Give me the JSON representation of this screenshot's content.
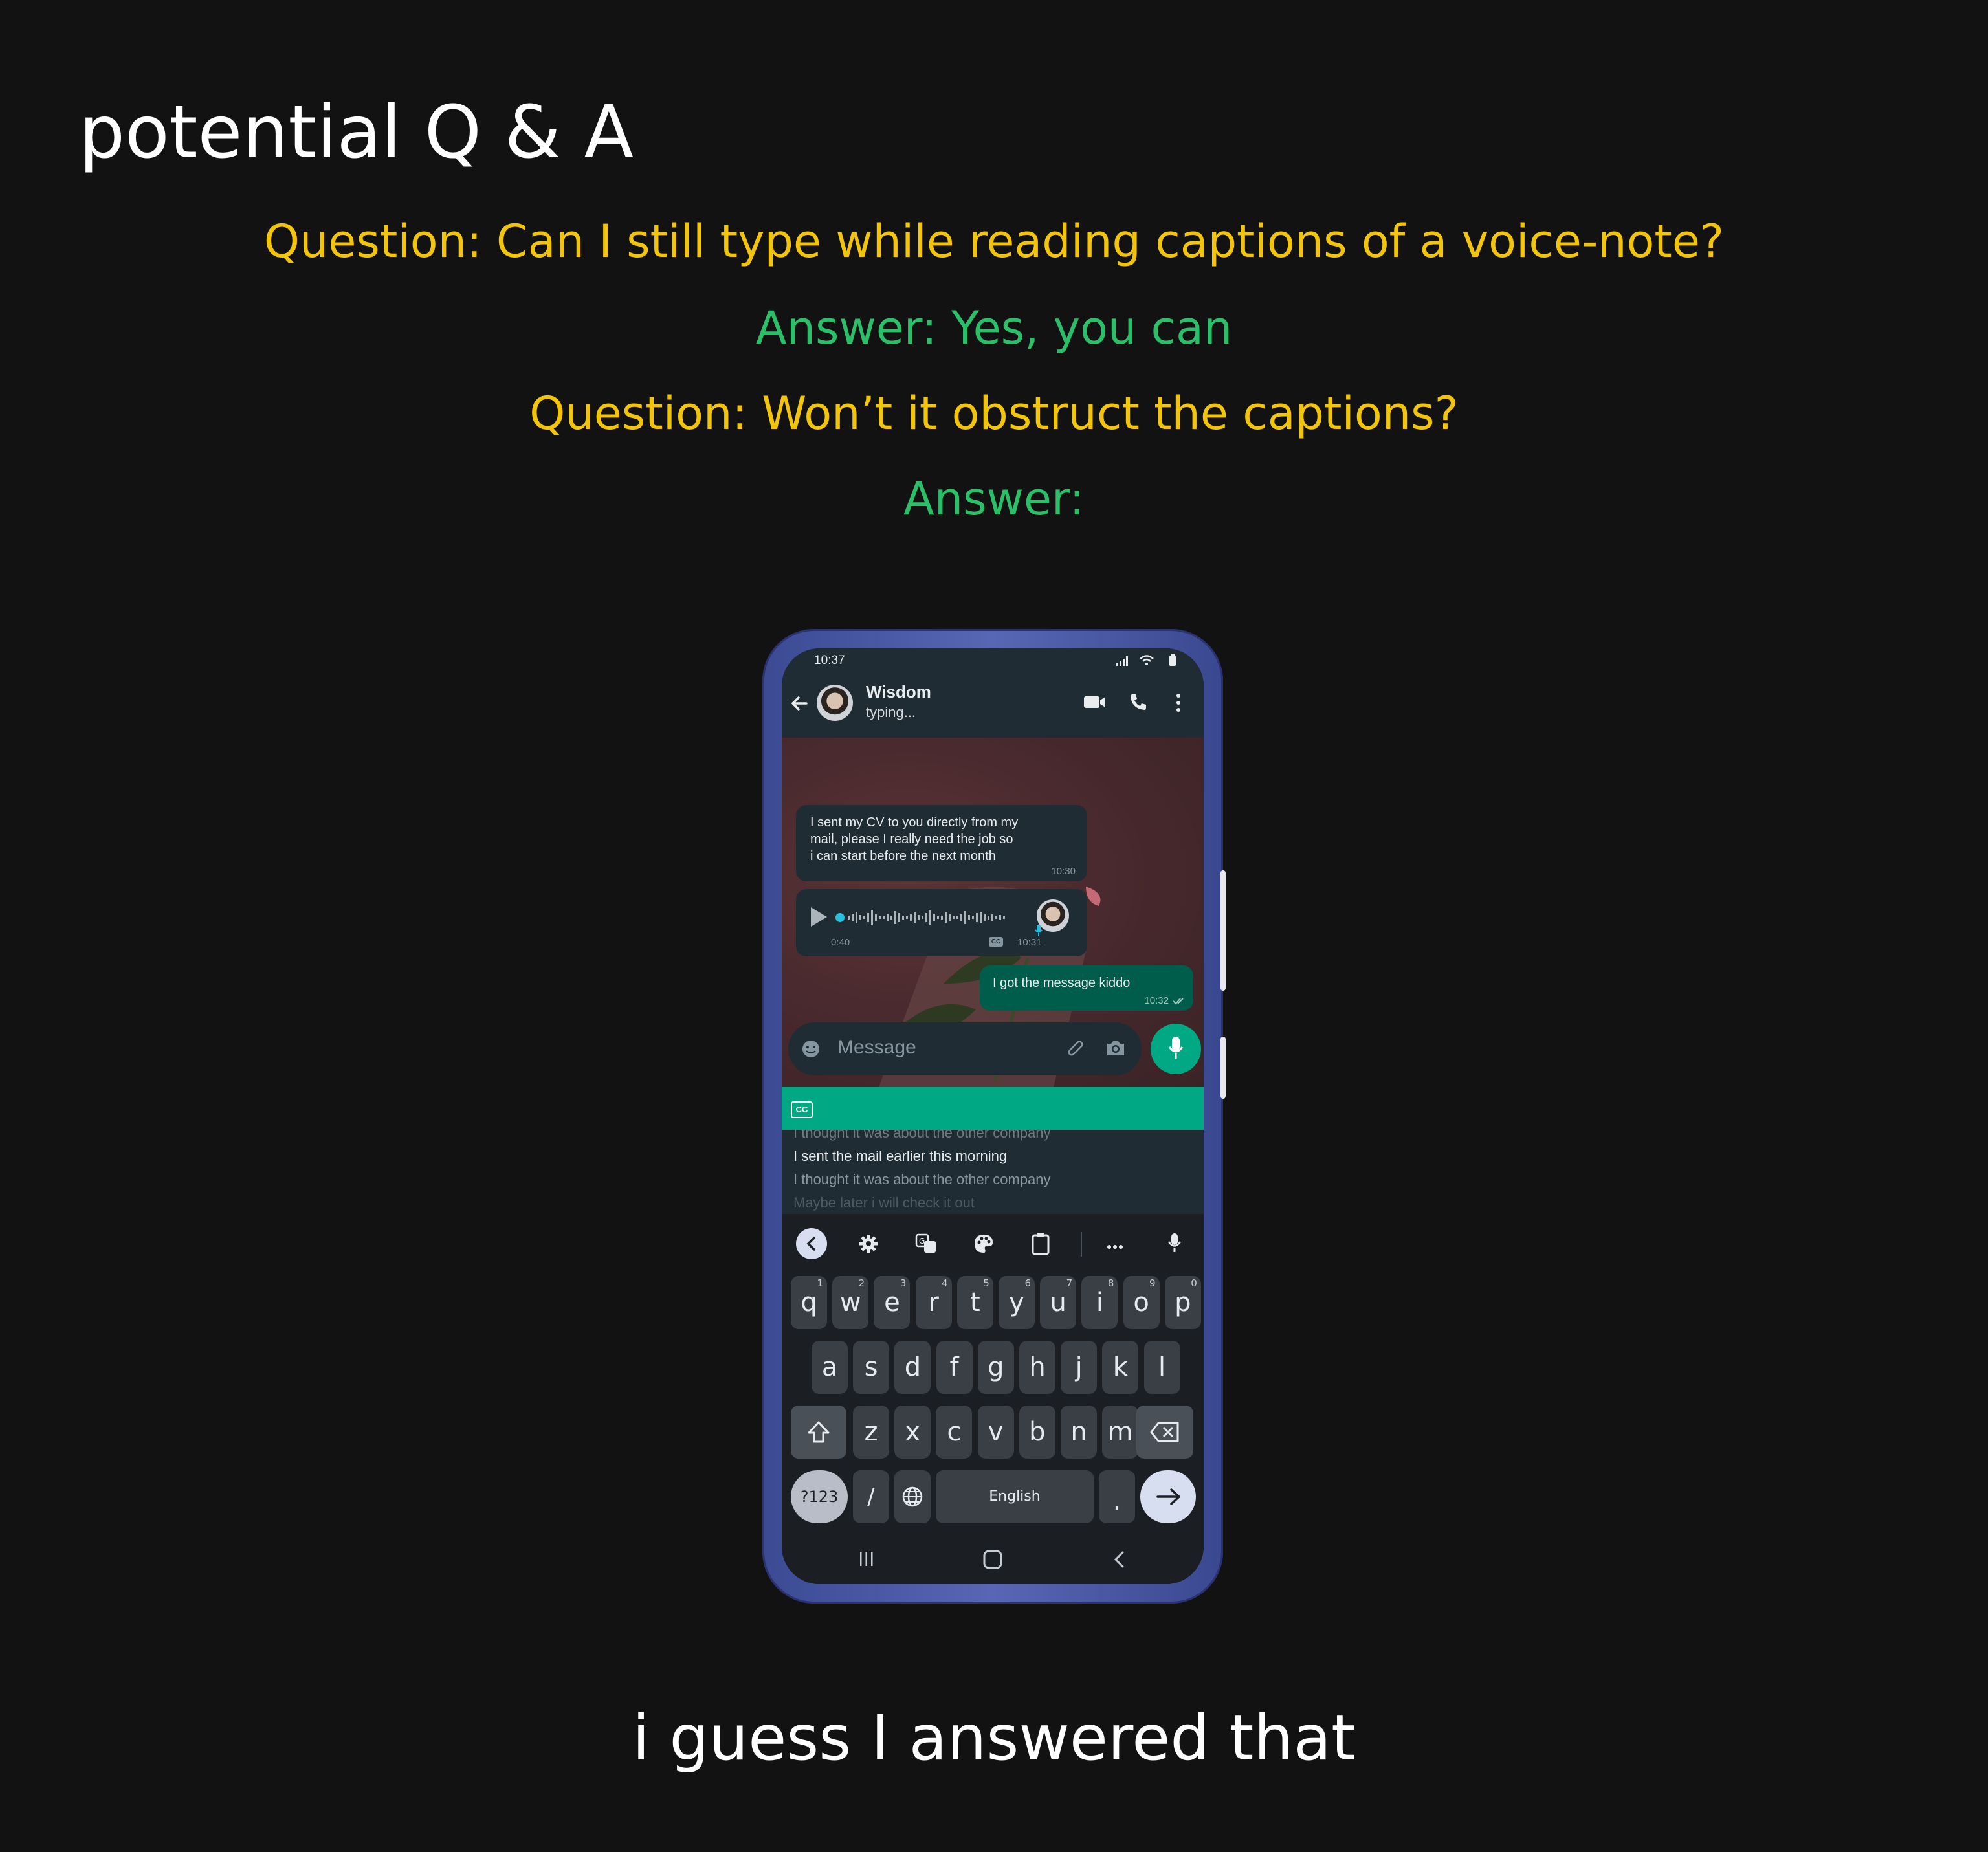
{
  "page": {
    "title": "potential Q & A",
    "question1": "Question: Can I still type while reading captions of a voice-note?",
    "answer1": "Answer: Yes, you can",
    "question2": "Question: Won’t it obstruct the captions?",
    "answer2": "Answer:",
    "footer": "i guess I answered that"
  },
  "colors": {
    "question": "#f2c40c",
    "answer": "#2bbf6a",
    "accent": "#00a884"
  },
  "phone": {
    "status_time": "10:37",
    "contact": {
      "name": "Wisdom",
      "status": "typing..."
    },
    "messages": {
      "m1_text_1": "I sent my CV to you directly from my",
      "m1_text_2": "mail, please I really need the job so",
      "m1_text_3": "i can start before the next month",
      "m1_time": "10:30",
      "voice_duration": "0:40",
      "voice_cc": "CC",
      "voice_time": "10:31",
      "out_text": "I got the message kiddo",
      "out_time": "10:32"
    },
    "composer": {
      "placeholder": "Message"
    },
    "captions": {
      "badge": "CC",
      "line_prev": "I thought it was about the other company",
      "line_current": "I sent the mail earlier this morning",
      "line_next": "I thought it was about the other company",
      "line_next2": "Maybe later i will check it out"
    },
    "keyboard": {
      "row1": [
        [
          "q",
          "1"
        ],
        [
          "w",
          "2"
        ],
        [
          "e",
          "3"
        ],
        [
          "r",
          "4"
        ],
        [
          "t",
          "5"
        ],
        [
          "y",
          "6"
        ],
        [
          "u",
          "7"
        ],
        [
          "i",
          "8"
        ],
        [
          "o",
          "9"
        ],
        [
          "p",
          "0"
        ]
      ],
      "row2": [
        "a",
        "s",
        "d",
        "f",
        "g",
        "h",
        "j",
        "k",
        "l"
      ],
      "row3": [
        "z",
        "x",
        "c",
        "v",
        "b",
        "n",
        "m"
      ],
      "sym": "?123",
      "slash": "/",
      "space": "English",
      "period": "."
    }
  }
}
